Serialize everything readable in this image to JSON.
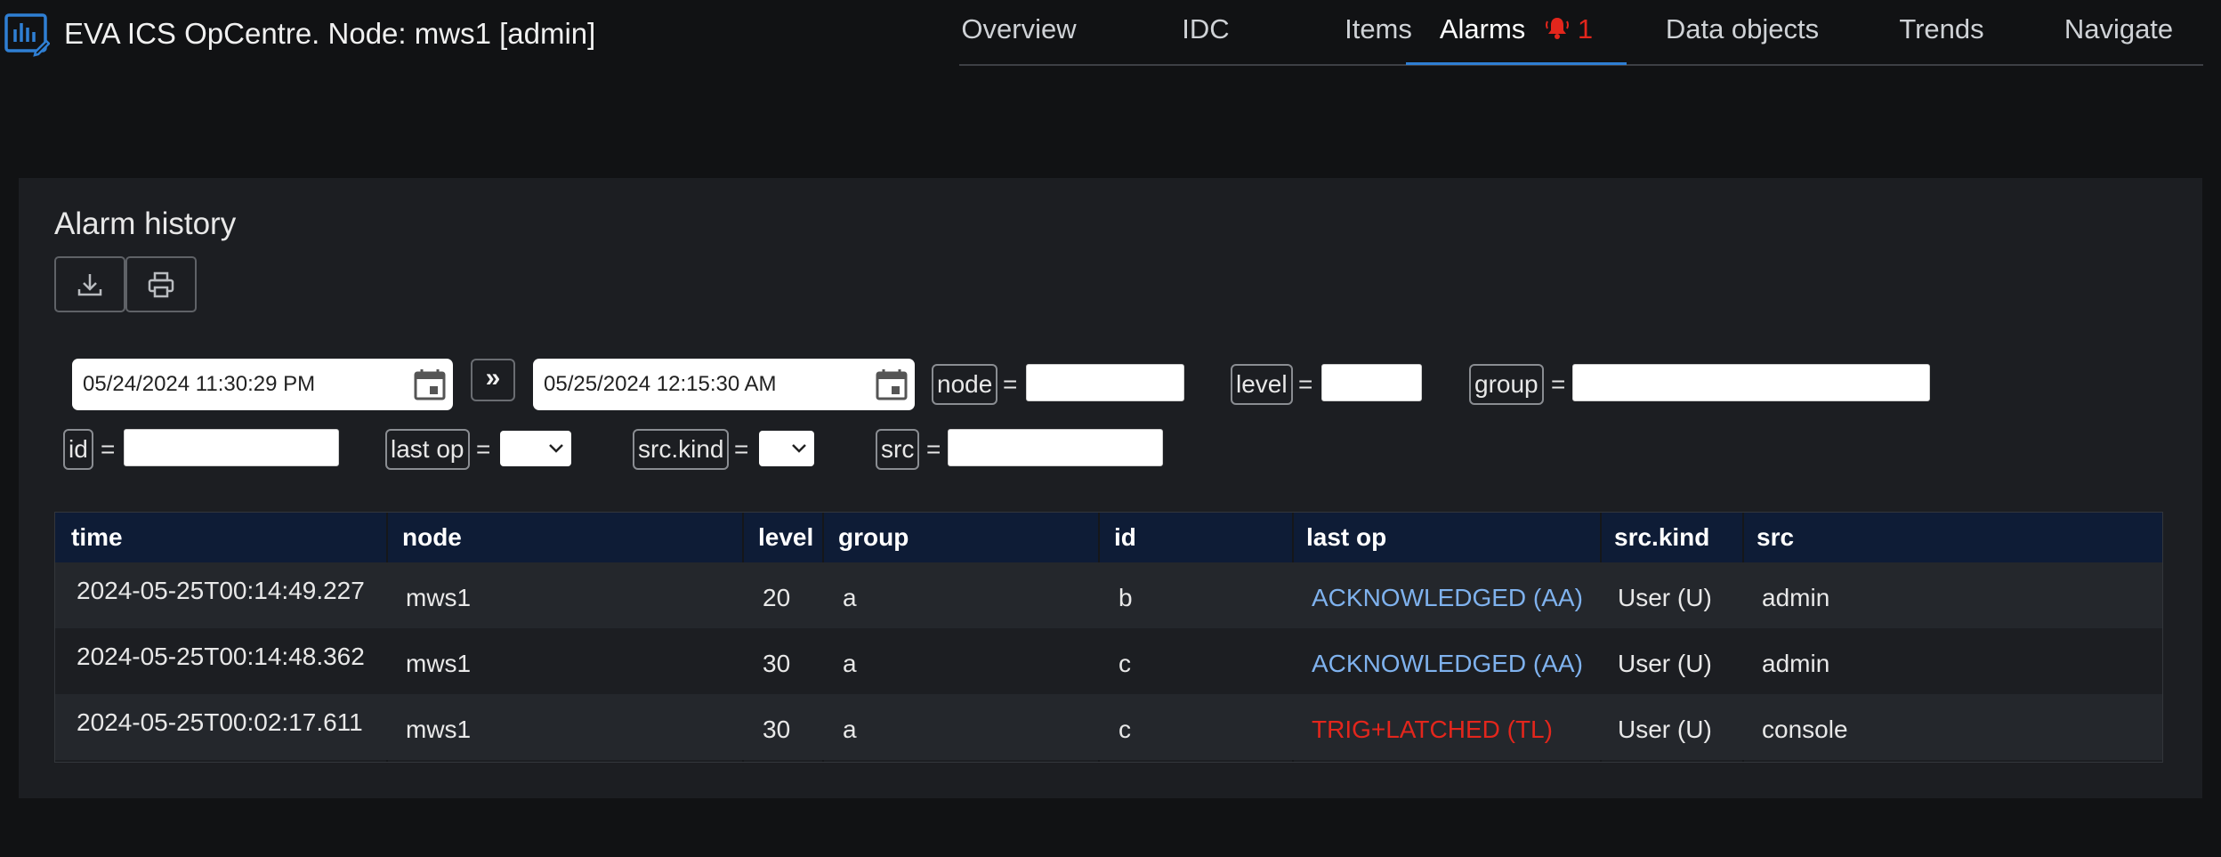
{
  "app": {
    "title": "EVA ICS OpCentre. Node: mws1 [admin]"
  },
  "nav": {
    "tabs": [
      {
        "label": "Overview"
      },
      {
        "label": "IDC"
      },
      {
        "label": "Items"
      },
      {
        "label": "Alarms",
        "badge": "1"
      },
      {
        "label": "Data objects"
      },
      {
        "label": "Trends"
      },
      {
        "label": "Navigate"
      }
    ],
    "active": "Alarms"
  },
  "panel": {
    "title": "Alarm history",
    "toolbar": {
      "download_icon": "download-icon",
      "print_icon": "printer-icon"
    }
  },
  "filters": {
    "date_from": "05/24/2024 11:30:29 PM",
    "date_to": "05/25/2024 12:15:30 AM",
    "range_symbol": "»",
    "eq": "=",
    "node": {
      "label": "node",
      "value": ""
    },
    "level": {
      "label": "level",
      "value": ""
    },
    "group": {
      "label": "group",
      "value": ""
    },
    "id": {
      "label": "id",
      "value": ""
    },
    "last_op": {
      "label": "last op",
      "value": ""
    },
    "src_kind": {
      "label": "src.kind",
      "value": ""
    },
    "src": {
      "label": "src",
      "value": ""
    }
  },
  "table": {
    "columns": [
      "time",
      "node",
      "level",
      "group",
      "id",
      "last op",
      "src.kind",
      "src"
    ],
    "rows": [
      {
        "time": "2024-05-25T00:14:49.227",
        "node": "mws1",
        "level": "20",
        "group": "a",
        "id": "b",
        "last_op": "ACKNOWLEDGED (AA)",
        "last_op_color": "#7fb2ee",
        "src_kind": "User (U)",
        "src": "admin"
      },
      {
        "time": "2024-05-25T00:14:48.362",
        "node": "mws1",
        "level": "30",
        "group": "a",
        "id": "c",
        "last_op": "ACKNOWLEDGED (AA)",
        "last_op_color": "#7fb2ee",
        "src_kind": "User (U)",
        "src": "admin"
      },
      {
        "time": "2024-05-25T00:02:17.611",
        "node": "mws1",
        "level": "30",
        "group": "a",
        "id": "c",
        "last_op": "TRIG+LATCHED (TL)",
        "last_op_color": "#e3261c",
        "src_kind": "User (U)",
        "src": "console"
      }
    ]
  },
  "colors": {
    "accent": "#2f7fd4",
    "alarm": "#e3261c",
    "header_row": "#0e1c36",
    "background": "#111214",
    "panel": "#1c1e22"
  }
}
